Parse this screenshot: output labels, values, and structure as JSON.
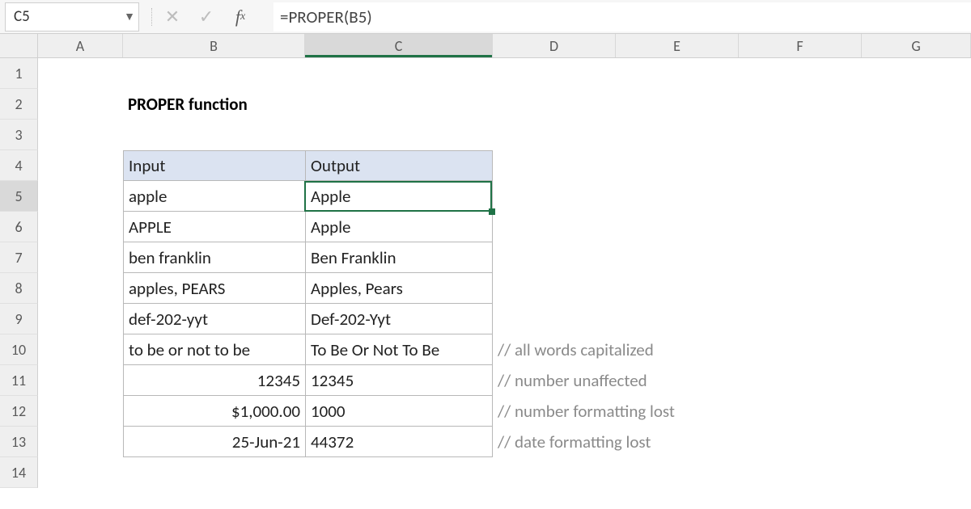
{
  "name_box": "C5",
  "formula": "=PROPER(B5)",
  "col_headers": [
    "A",
    "B",
    "C",
    "D",
    "E",
    "F",
    "G"
  ],
  "row_headers": [
    "1",
    "2",
    "3",
    "4",
    "5",
    "6",
    "7",
    "8",
    "9",
    "10",
    "11",
    "12",
    "13",
    "14"
  ],
  "active_col": "C",
  "active_row": "5",
  "title": "PROPER function",
  "table": {
    "header": {
      "input": "Input",
      "output": "Output"
    },
    "rows": [
      {
        "input": "apple",
        "input_align": "left",
        "output": "Apple"
      },
      {
        "input": "APPLE",
        "input_align": "left",
        "output": "Apple"
      },
      {
        "input": "ben franklin",
        "input_align": "left",
        "output": "Ben Franklin"
      },
      {
        "input": "apples, PEARS",
        "input_align": "left",
        "output": "Apples, Pears"
      },
      {
        "input": "def-202-yyt",
        "input_align": "left",
        "output": "Def-202-Yyt"
      },
      {
        "input": "to be or not to be",
        "input_align": "left",
        "output": "To Be Or Not To Be",
        "comment": "// all words capitalized"
      },
      {
        "input": "12345",
        "input_align": "right",
        "output": "12345",
        "comment": "// number unaffected"
      },
      {
        "input": "$1,000.00",
        "input_align": "right",
        "output": "1000",
        "comment": "// number formatting lost"
      },
      {
        "input": "25-Jun-21",
        "input_align": "right",
        "output": "44372",
        "comment": "// date formatting lost"
      }
    ]
  },
  "colors": {
    "selection": "#1f7246",
    "header_fill": "#dbe3f1"
  }
}
